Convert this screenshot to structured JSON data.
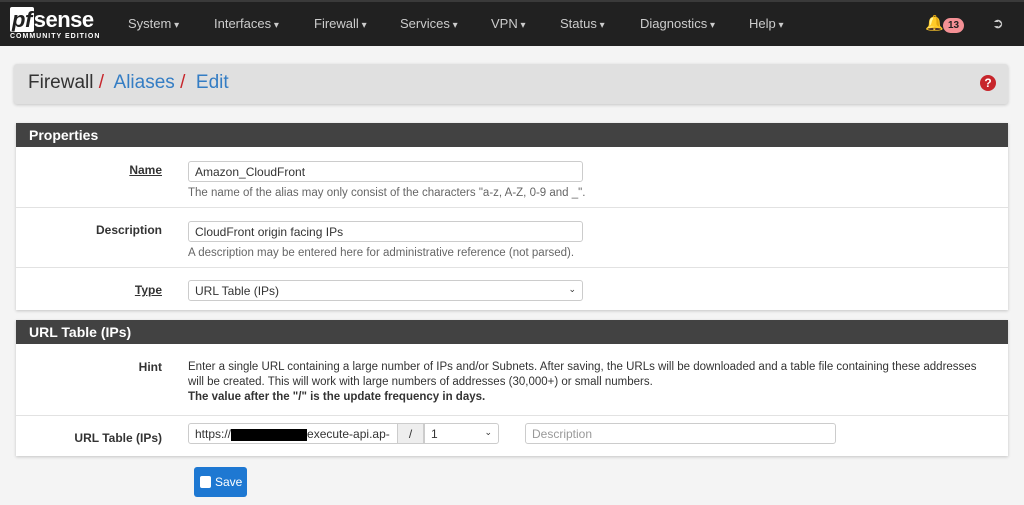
{
  "nav": {
    "logo": "pfsense",
    "logo_sub": "COMMUNITY EDITION",
    "items": [
      "System",
      "Interfaces",
      "Firewall",
      "Services",
      "VPN",
      "Status",
      "Diagnostics",
      "Help"
    ],
    "notifications": "13"
  },
  "breadcrumb": {
    "root": "Firewall",
    "sep": "/",
    "aliases": "Aliases",
    "edit": "Edit"
  },
  "properties": {
    "title": "Properties",
    "name_label": "Name",
    "name_value": "Amazon_CloudFront",
    "name_help": "The name of the alias may only consist of the characters \"a-z, A-Z, 0-9 and _\".",
    "desc_label": "Description",
    "desc_value": "CloudFront origin facing IPs",
    "desc_help": "A description may be entered here for administrative reference (not parsed).",
    "type_label": "Type",
    "type_value": "URL Table (IPs)"
  },
  "urltable": {
    "title": "URL Table (IPs)",
    "hint_label": "Hint",
    "hint_text": "Enter a single URL containing a large number of IPs and/or Subnets. After saving, the URLs will be downloaded and a table file containing these addresses will be created. This will work with large numbers of addresses (30,000+) or small numbers.",
    "hint_bold": "The value after the \"/\" is the update frequency in days.",
    "row_label": "URL Table (IPs)",
    "url_prefix": "https://",
    "url_suffix": "execute-api.ap-",
    "slash": "/",
    "freq": "1",
    "desc_placeholder": "Description"
  },
  "save_label": "Save"
}
